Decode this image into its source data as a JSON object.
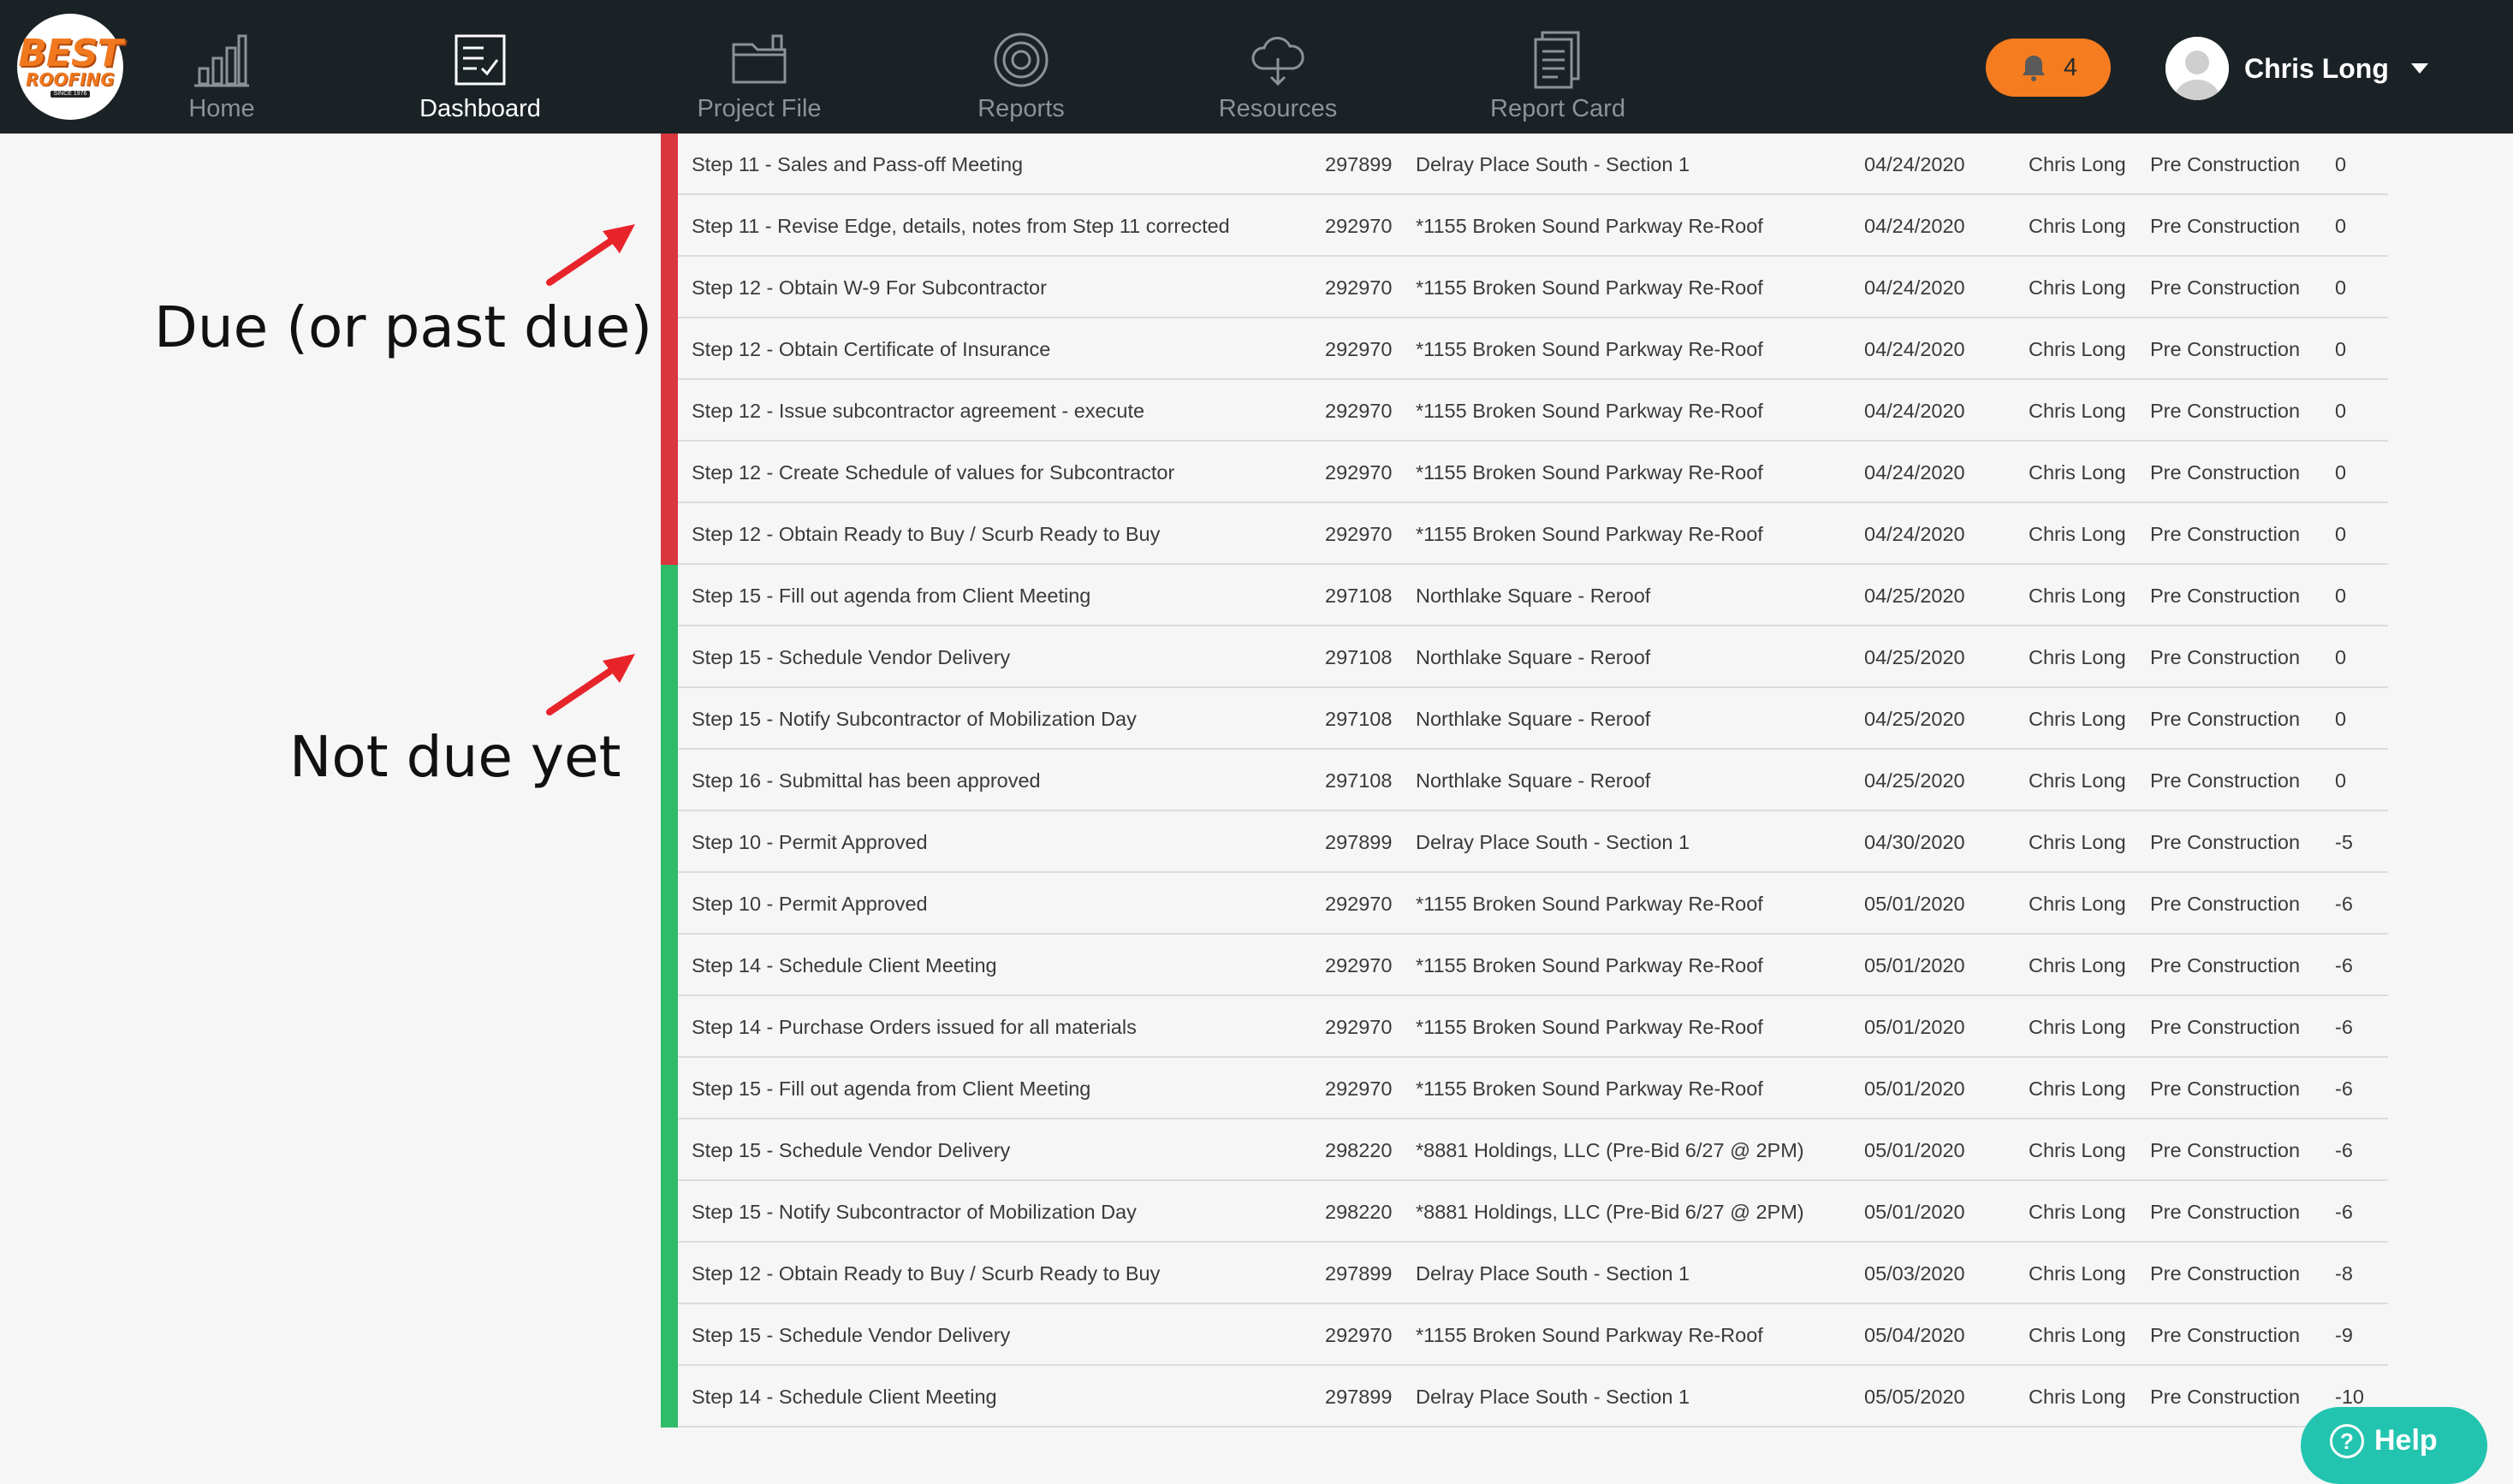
{
  "nav": {
    "logo_top": "BEST",
    "logo_bottom": "ROOFING",
    "logo_since": "SINCE 1976",
    "items": [
      {
        "label": "Home",
        "icon": "bar-chart-icon",
        "active": false
      },
      {
        "label": "Dashboard",
        "icon": "checklist-icon",
        "active": true
      },
      {
        "label": "Project File",
        "icon": "folder-icon",
        "active": false
      },
      {
        "label": "Reports",
        "icon": "target-icon",
        "active": false
      },
      {
        "label": "Resources",
        "icon": "cloud-download-icon",
        "active": false
      },
      {
        "label": "Report Card",
        "icon": "document-icon",
        "active": false
      }
    ],
    "notification_count": "4",
    "user_name": "Chris Long"
  },
  "annotations": {
    "due": "Due (or past due)",
    "not_due": "Not due yet",
    "arrow_color": "#e8242b"
  },
  "colors": {
    "due": "#d9363e",
    "not_due": "#2fbb6a",
    "accent": "#f57c1f",
    "help": "#22c4b0"
  },
  "tasks": [
    {
      "status": "due",
      "task": "Step 11 - Sales and Pass-off Meeting",
      "number": "297899",
      "project": "Delray Place South - Section 1",
      "date": "04/24/2020",
      "user": "Chris Long",
      "stage": "Pre Construction",
      "days": "0"
    },
    {
      "status": "due",
      "task": "Step 11 - Revise Edge, details, notes from Step 11 corrected",
      "number": "292970",
      "project": "*1155 Broken Sound Parkway Re-Roof",
      "date": "04/24/2020",
      "user": "Chris Long",
      "stage": "Pre Construction",
      "days": "0"
    },
    {
      "status": "due",
      "task": "Step 12 - Obtain W-9 For Subcontractor",
      "number": "292970",
      "project": "*1155 Broken Sound Parkway Re-Roof",
      "date": "04/24/2020",
      "user": "Chris Long",
      "stage": "Pre Construction",
      "days": "0"
    },
    {
      "status": "due",
      "task": "Step 12 - Obtain Certificate of Insurance",
      "number": "292970",
      "project": "*1155 Broken Sound Parkway Re-Roof",
      "date": "04/24/2020",
      "user": "Chris Long",
      "stage": "Pre Construction",
      "days": "0"
    },
    {
      "status": "due",
      "task": "Step 12 - Issue subcontractor agreement - execute",
      "number": "292970",
      "project": "*1155 Broken Sound Parkway Re-Roof",
      "date": "04/24/2020",
      "user": "Chris Long",
      "stage": "Pre Construction",
      "days": "0"
    },
    {
      "status": "due",
      "task": "Step 12 - Create Schedule of values for Subcontractor",
      "number": "292970",
      "project": "*1155 Broken Sound Parkway Re-Roof",
      "date": "04/24/2020",
      "user": "Chris Long",
      "stage": "Pre Construction",
      "days": "0"
    },
    {
      "status": "due",
      "task": "Step 12 - Obtain Ready to Buy / Scurb Ready to Buy",
      "number": "292970",
      "project": "*1155 Broken Sound Parkway Re-Roof",
      "date": "04/24/2020",
      "user": "Chris Long",
      "stage": "Pre Construction",
      "days": "0"
    },
    {
      "status": "ok",
      "task": "Step 15 - Fill out agenda from Client Meeting",
      "number": "297108",
      "project": "Northlake Square - Reroof",
      "date": "04/25/2020",
      "user": "Chris Long",
      "stage": "Pre Construction",
      "days": "0"
    },
    {
      "status": "ok",
      "task": "Step 15 - Schedule Vendor Delivery",
      "number": "297108",
      "project": "Northlake Square - Reroof",
      "date": "04/25/2020",
      "user": "Chris Long",
      "stage": "Pre Construction",
      "days": "0"
    },
    {
      "status": "ok",
      "task": "Step 15 - Notify Subcontractor of Mobilization Day",
      "number": "297108",
      "project": "Northlake Square - Reroof",
      "date": "04/25/2020",
      "user": "Chris Long",
      "stage": "Pre Construction",
      "days": "0"
    },
    {
      "status": "ok",
      "task": "Step 16 - Submittal has been approved",
      "number": "297108",
      "project": "Northlake Square - Reroof",
      "date": "04/25/2020",
      "user": "Chris Long",
      "stage": "Pre Construction",
      "days": "0"
    },
    {
      "status": "ok",
      "task": "Step 10 - Permit Approved",
      "number": "297899",
      "project": "Delray Place South - Section 1",
      "date": "04/30/2020",
      "user": "Chris Long",
      "stage": "Pre Construction",
      "days": "-5"
    },
    {
      "status": "ok",
      "task": "Step 10 - Permit Approved",
      "number": "292970",
      "project": "*1155 Broken Sound Parkway Re-Roof",
      "date": "05/01/2020",
      "user": "Chris Long",
      "stage": "Pre Construction",
      "days": "-6"
    },
    {
      "status": "ok",
      "task": "Step 14 - Schedule Client Meeting",
      "number": "292970",
      "project": "*1155 Broken Sound Parkway Re-Roof",
      "date": "05/01/2020",
      "user": "Chris Long",
      "stage": "Pre Construction",
      "days": "-6"
    },
    {
      "status": "ok",
      "task": "Step 14 - Purchase Orders issued for all materials",
      "number": "292970",
      "project": "*1155 Broken Sound Parkway Re-Roof",
      "date": "05/01/2020",
      "user": "Chris Long",
      "stage": "Pre Construction",
      "days": "-6"
    },
    {
      "status": "ok",
      "task": "Step 15 - Fill out agenda from Client Meeting",
      "number": "292970",
      "project": "*1155 Broken Sound Parkway Re-Roof",
      "date": "05/01/2020",
      "user": "Chris Long",
      "stage": "Pre Construction",
      "days": "-6"
    },
    {
      "status": "ok",
      "task": "Step 15 - Schedule Vendor Delivery",
      "number": "298220",
      "project": "*8881 Holdings, LLC (Pre-Bid 6/27 @ 2PM)",
      "date": "05/01/2020",
      "user": "Chris Long",
      "stage": "Pre Construction",
      "days": "-6"
    },
    {
      "status": "ok",
      "task": "Step 15 - Notify Subcontractor of Mobilization Day",
      "number": "298220",
      "project": "*8881 Holdings, LLC (Pre-Bid 6/27 @ 2PM)",
      "date": "05/01/2020",
      "user": "Chris Long",
      "stage": "Pre Construction",
      "days": "-6"
    },
    {
      "status": "ok",
      "task": "Step 12 - Obtain Ready to Buy / Scurb Ready to Buy",
      "number": "297899",
      "project": "Delray Place South - Section 1",
      "date": "05/03/2020",
      "user": "Chris Long",
      "stage": "Pre Construction",
      "days": "-8"
    },
    {
      "status": "ok",
      "task": "Step 15 - Schedule Vendor Delivery",
      "number": "292970",
      "project": "*1155 Broken Sound Parkway Re-Roof",
      "date": "05/04/2020",
      "user": "Chris Long",
      "stage": "Pre Construction",
      "days": "-9"
    },
    {
      "status": "ok",
      "task": "Step 14 - Schedule Client Meeting",
      "number": "297899",
      "project": "Delray Place South - Section 1",
      "date": "05/05/2020",
      "user": "Chris Long",
      "stage": "Pre Construction",
      "days": "-10"
    }
  ],
  "help": {
    "label": "Help"
  }
}
